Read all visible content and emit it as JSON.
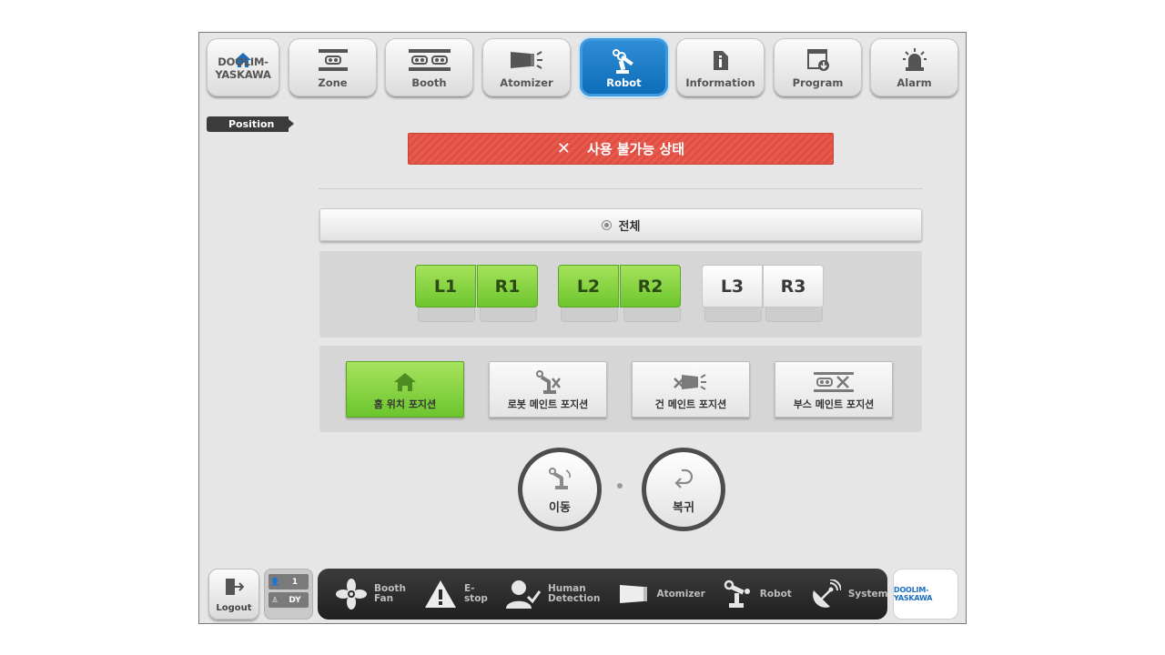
{
  "nav": {
    "home": {
      "logo": "DOOLIM-YASKAWA"
    },
    "items": [
      {
        "label": "Zone",
        "icon": "zone-icon"
      },
      {
        "label": "Booth",
        "icon": "booth-icon"
      },
      {
        "label": "Atomizer",
        "icon": "atomizer-icon"
      },
      {
        "label": "Robot",
        "icon": "robot-arm-icon",
        "active": true
      },
      {
        "label": "Information",
        "icon": "information-icon"
      },
      {
        "label": "Program",
        "icon": "program-icon"
      },
      {
        "label": "Alarm",
        "icon": "alarm-icon"
      }
    ]
  },
  "section_tag": "Position",
  "status_banner": {
    "icon": "close-icon",
    "text": "사용 불가능 상태",
    "color": "#e85a4d"
  },
  "select_all": {
    "label": "전체"
  },
  "robots": [
    {
      "label": "L1",
      "selected": true
    },
    {
      "label": "R1",
      "selected": true
    },
    {
      "label": "L2",
      "selected": true
    },
    {
      "label": "R2",
      "selected": true
    },
    {
      "label": "L3",
      "selected": false
    },
    {
      "label": "R3",
      "selected": false
    }
  ],
  "positions": [
    {
      "label": "홈 위치 포지션",
      "icon": "home-icon",
      "selected": true
    },
    {
      "label": "로봇 메인트 포지션",
      "icon": "robot-maintenance-icon",
      "selected": false
    },
    {
      "label": "건 메인트 포지션",
      "icon": "gun-maintenance-icon",
      "selected": false
    },
    {
      "label": "부스 메인트 포지션",
      "icon": "booth-maintenance-icon",
      "selected": false
    }
  ],
  "actions": {
    "move": {
      "label": "이동",
      "icon": "robot-move-icon"
    },
    "return": {
      "label": "복귀",
      "icon": "return-icon"
    }
  },
  "footer": {
    "logout": {
      "label": "Logout"
    },
    "user": {
      "level": "1",
      "name": "DY"
    },
    "status_items": [
      {
        "label_line1": "Booth",
        "label_line2": "Fan",
        "icon": "fan-icon"
      },
      {
        "label_line1": "E-stop",
        "label_line2": "",
        "icon": "warning-icon"
      },
      {
        "label_line1": "Human",
        "label_line2": "Detection",
        "icon": "human-detection-icon"
      },
      {
        "label_line1": "Atomizer",
        "label_line2": "",
        "icon": "atomizer-icon"
      },
      {
        "label_line1": "Robot",
        "label_line2": "",
        "icon": "robot-arm-icon"
      },
      {
        "label_line1": "System",
        "label_line2": "",
        "icon": "satellite-icon"
      }
    ],
    "brand": "DOOLIM-YASKAWA"
  },
  "colors": {
    "accent": "#1a6fc0",
    "active_green": "#7fd03c",
    "alert_red": "#e85a4d"
  }
}
